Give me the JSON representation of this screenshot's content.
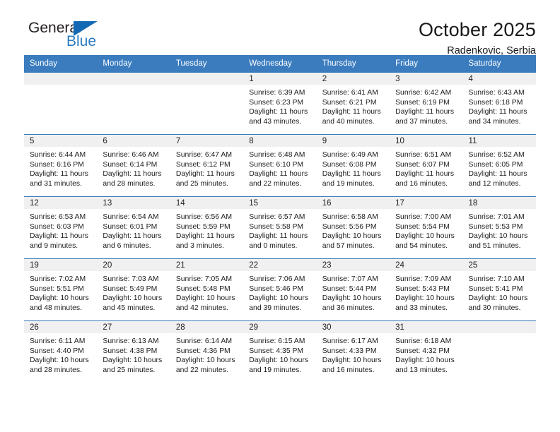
{
  "brand": {
    "name_top": "General",
    "name_bottom": "Blue",
    "mark": "triangle-flag-icon",
    "color_blue": "#1268b3",
    "color_text_blue": "#2a7bc0"
  },
  "header": {
    "title": "October 2025",
    "subtitle": "Radenkovic, Serbia"
  },
  "theme": {
    "header_row_bg": "#3a7cbe",
    "header_row_text": "#ffffff",
    "daynum_band_bg": "#f0f0f0",
    "cell_bg": "#ffffff",
    "week_divider": "#3a7cbe"
  },
  "weekdays": [
    "Sunday",
    "Monday",
    "Tuesday",
    "Wednesday",
    "Thursday",
    "Friday",
    "Saturday"
  ],
  "labels": {
    "sunrise": "Sunrise:",
    "sunset": "Sunset:",
    "daylight": "Daylight:"
  },
  "weeks": [
    [
      {
        "day": "",
        "sunrise": "",
        "sunset": "",
        "daylight_l1": "",
        "daylight_l2": ""
      },
      {
        "day": "",
        "sunrise": "",
        "sunset": "",
        "daylight_l1": "",
        "daylight_l2": ""
      },
      {
        "day": "",
        "sunrise": "",
        "sunset": "",
        "daylight_l1": "",
        "daylight_l2": ""
      },
      {
        "day": "1",
        "sunrise": "Sunrise: 6:39 AM",
        "sunset": "Sunset: 6:23 PM",
        "daylight_l1": "Daylight: 11 hours",
        "daylight_l2": "and 43 minutes."
      },
      {
        "day": "2",
        "sunrise": "Sunrise: 6:41 AM",
        "sunset": "Sunset: 6:21 PM",
        "daylight_l1": "Daylight: 11 hours",
        "daylight_l2": "and 40 minutes."
      },
      {
        "day": "3",
        "sunrise": "Sunrise: 6:42 AM",
        "sunset": "Sunset: 6:19 PM",
        "daylight_l1": "Daylight: 11 hours",
        "daylight_l2": "and 37 minutes."
      },
      {
        "day": "4",
        "sunrise": "Sunrise: 6:43 AM",
        "sunset": "Sunset: 6:18 PM",
        "daylight_l1": "Daylight: 11 hours",
        "daylight_l2": "and 34 minutes."
      }
    ],
    [
      {
        "day": "5",
        "sunrise": "Sunrise: 6:44 AM",
        "sunset": "Sunset: 6:16 PM",
        "daylight_l1": "Daylight: 11 hours",
        "daylight_l2": "and 31 minutes."
      },
      {
        "day": "6",
        "sunrise": "Sunrise: 6:46 AM",
        "sunset": "Sunset: 6:14 PM",
        "daylight_l1": "Daylight: 11 hours",
        "daylight_l2": "and 28 minutes."
      },
      {
        "day": "7",
        "sunrise": "Sunrise: 6:47 AM",
        "sunset": "Sunset: 6:12 PM",
        "daylight_l1": "Daylight: 11 hours",
        "daylight_l2": "and 25 minutes."
      },
      {
        "day": "8",
        "sunrise": "Sunrise: 6:48 AM",
        "sunset": "Sunset: 6:10 PM",
        "daylight_l1": "Daylight: 11 hours",
        "daylight_l2": "and 22 minutes."
      },
      {
        "day": "9",
        "sunrise": "Sunrise: 6:49 AM",
        "sunset": "Sunset: 6:08 PM",
        "daylight_l1": "Daylight: 11 hours",
        "daylight_l2": "and 19 minutes."
      },
      {
        "day": "10",
        "sunrise": "Sunrise: 6:51 AM",
        "sunset": "Sunset: 6:07 PM",
        "daylight_l1": "Daylight: 11 hours",
        "daylight_l2": "and 16 minutes."
      },
      {
        "day": "11",
        "sunrise": "Sunrise: 6:52 AM",
        "sunset": "Sunset: 6:05 PM",
        "daylight_l1": "Daylight: 11 hours",
        "daylight_l2": "and 12 minutes."
      }
    ],
    [
      {
        "day": "12",
        "sunrise": "Sunrise: 6:53 AM",
        "sunset": "Sunset: 6:03 PM",
        "daylight_l1": "Daylight: 11 hours",
        "daylight_l2": "and 9 minutes."
      },
      {
        "day": "13",
        "sunrise": "Sunrise: 6:54 AM",
        "sunset": "Sunset: 6:01 PM",
        "daylight_l1": "Daylight: 11 hours",
        "daylight_l2": "and 6 minutes."
      },
      {
        "day": "14",
        "sunrise": "Sunrise: 6:56 AM",
        "sunset": "Sunset: 5:59 PM",
        "daylight_l1": "Daylight: 11 hours",
        "daylight_l2": "and 3 minutes."
      },
      {
        "day": "15",
        "sunrise": "Sunrise: 6:57 AM",
        "sunset": "Sunset: 5:58 PM",
        "daylight_l1": "Daylight: 11 hours",
        "daylight_l2": "and 0 minutes."
      },
      {
        "day": "16",
        "sunrise": "Sunrise: 6:58 AM",
        "sunset": "Sunset: 5:56 PM",
        "daylight_l1": "Daylight: 10 hours",
        "daylight_l2": "and 57 minutes."
      },
      {
        "day": "17",
        "sunrise": "Sunrise: 7:00 AM",
        "sunset": "Sunset: 5:54 PM",
        "daylight_l1": "Daylight: 10 hours",
        "daylight_l2": "and 54 minutes."
      },
      {
        "day": "18",
        "sunrise": "Sunrise: 7:01 AM",
        "sunset": "Sunset: 5:53 PM",
        "daylight_l1": "Daylight: 10 hours",
        "daylight_l2": "and 51 minutes."
      }
    ],
    [
      {
        "day": "19",
        "sunrise": "Sunrise: 7:02 AM",
        "sunset": "Sunset: 5:51 PM",
        "daylight_l1": "Daylight: 10 hours",
        "daylight_l2": "and 48 minutes."
      },
      {
        "day": "20",
        "sunrise": "Sunrise: 7:03 AM",
        "sunset": "Sunset: 5:49 PM",
        "daylight_l1": "Daylight: 10 hours",
        "daylight_l2": "and 45 minutes."
      },
      {
        "day": "21",
        "sunrise": "Sunrise: 7:05 AM",
        "sunset": "Sunset: 5:48 PM",
        "daylight_l1": "Daylight: 10 hours",
        "daylight_l2": "and 42 minutes."
      },
      {
        "day": "22",
        "sunrise": "Sunrise: 7:06 AM",
        "sunset": "Sunset: 5:46 PM",
        "daylight_l1": "Daylight: 10 hours",
        "daylight_l2": "and 39 minutes."
      },
      {
        "day": "23",
        "sunrise": "Sunrise: 7:07 AM",
        "sunset": "Sunset: 5:44 PM",
        "daylight_l1": "Daylight: 10 hours",
        "daylight_l2": "and 36 minutes."
      },
      {
        "day": "24",
        "sunrise": "Sunrise: 7:09 AM",
        "sunset": "Sunset: 5:43 PM",
        "daylight_l1": "Daylight: 10 hours",
        "daylight_l2": "and 33 minutes."
      },
      {
        "day": "25",
        "sunrise": "Sunrise: 7:10 AM",
        "sunset": "Sunset: 5:41 PM",
        "daylight_l1": "Daylight: 10 hours",
        "daylight_l2": "and 30 minutes."
      }
    ],
    [
      {
        "day": "26",
        "sunrise": "Sunrise: 6:11 AM",
        "sunset": "Sunset: 4:40 PM",
        "daylight_l1": "Daylight: 10 hours",
        "daylight_l2": "and 28 minutes."
      },
      {
        "day": "27",
        "sunrise": "Sunrise: 6:13 AM",
        "sunset": "Sunset: 4:38 PM",
        "daylight_l1": "Daylight: 10 hours",
        "daylight_l2": "and 25 minutes."
      },
      {
        "day": "28",
        "sunrise": "Sunrise: 6:14 AM",
        "sunset": "Sunset: 4:36 PM",
        "daylight_l1": "Daylight: 10 hours",
        "daylight_l2": "and 22 minutes."
      },
      {
        "day": "29",
        "sunrise": "Sunrise: 6:15 AM",
        "sunset": "Sunset: 4:35 PM",
        "daylight_l1": "Daylight: 10 hours",
        "daylight_l2": "and 19 minutes."
      },
      {
        "day": "30",
        "sunrise": "Sunrise: 6:17 AM",
        "sunset": "Sunset: 4:33 PM",
        "daylight_l1": "Daylight: 10 hours",
        "daylight_l2": "and 16 minutes."
      },
      {
        "day": "31",
        "sunrise": "Sunrise: 6:18 AM",
        "sunset": "Sunset: 4:32 PM",
        "daylight_l1": "Daylight: 10 hours",
        "daylight_l2": "and 13 minutes."
      },
      {
        "day": "",
        "sunrise": "",
        "sunset": "",
        "daylight_l1": "",
        "daylight_l2": ""
      }
    ]
  ]
}
